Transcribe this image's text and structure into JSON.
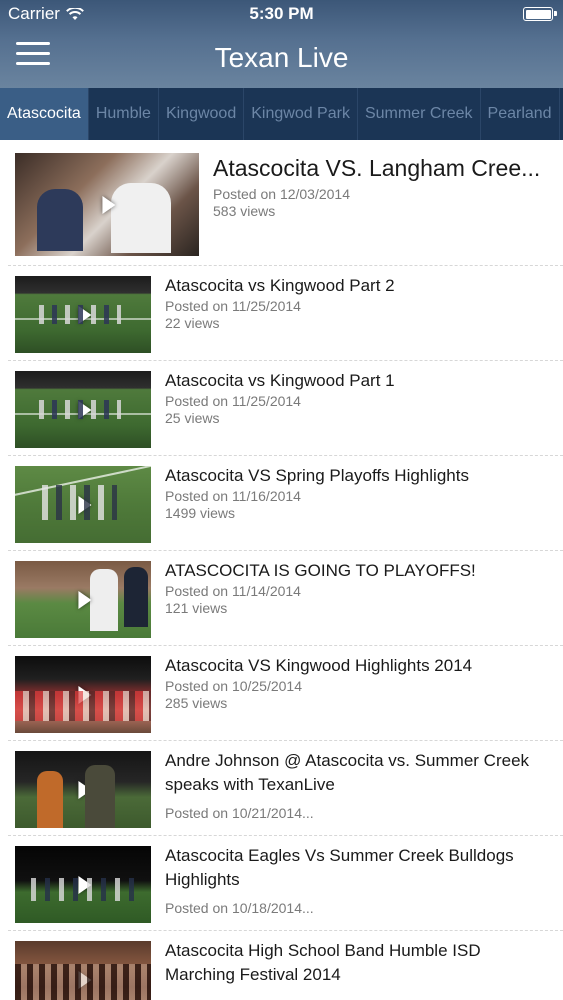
{
  "status_bar": {
    "carrier": "Carrier",
    "time": "5:30 PM"
  },
  "header": {
    "title": "Texan Live",
    "menu_icon": "hamburger-menu-icon"
  },
  "tabs": [
    {
      "label": "Atascocita",
      "active": true
    },
    {
      "label": "Humble",
      "active": false
    },
    {
      "label": "Kingwood",
      "active": false
    },
    {
      "label": "Kingwod Park",
      "active": false
    },
    {
      "label": "Summer Creek",
      "active": false
    },
    {
      "label": "Pearland",
      "active": false
    }
  ],
  "videos": [
    {
      "title": "Atascocita VS. Langham Cree...",
      "date": "Posted on 12/03/2014",
      "views": "583 views"
    },
    {
      "title": "Atascocita vs Kingwood Part 2",
      "date": "Posted on 11/25/2014",
      "views": "22 views"
    },
    {
      "title": "Atascocita vs Kingwood Part 1",
      "date": "Posted on 11/25/2014",
      "views": "25 views"
    },
    {
      "title": "Atascocita VS Spring Playoffs Highlights",
      "date": "Posted on 11/16/2014",
      "views": "1499 views"
    },
    {
      "title": "ATASCOCITA IS GOING TO PLAYOFFS!",
      "date": "Posted on 11/14/2014",
      "views": "121 views"
    },
    {
      "title": "Atascocita VS Kingwood Highlights 2014",
      "date": "Posted on 10/25/2014",
      "views": "285 views"
    },
    {
      "title": "Andre Johnson @ Atascocita vs. Summer Creek speaks with TexanLive",
      "date": "Posted on 10/21/2014...",
      "views": ""
    },
    {
      "title": "Atascocita Eagles Vs Summer Creek Bulldogs Highlights",
      "date": "Posted on 10/18/2014...",
      "views": ""
    },
    {
      "title": "Atascocita High School Band Humble ISD Marching Festival 2014",
      "date": "",
      "views": ""
    }
  ],
  "colors": {
    "nav_bar": "#557090",
    "tab_bar": "#1b3555",
    "tab_active": "#3a5e86"
  }
}
